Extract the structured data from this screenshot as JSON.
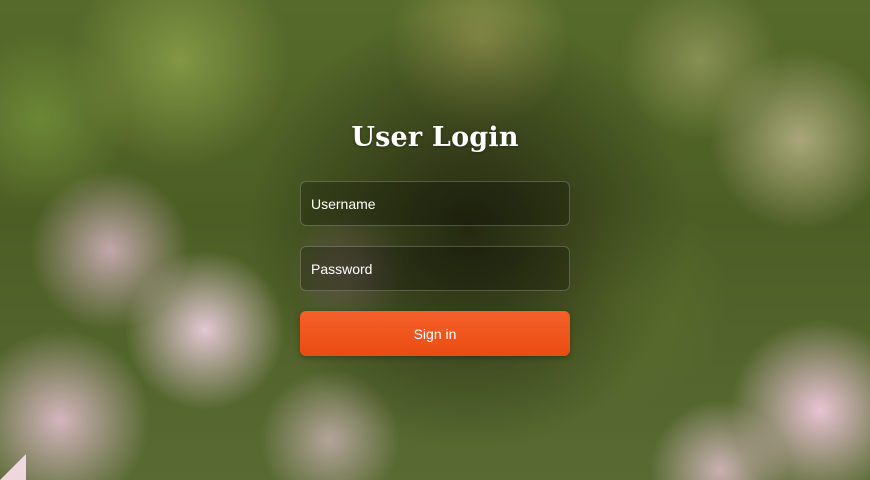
{
  "login": {
    "title": "User Login",
    "username_placeholder": "Username",
    "password_placeholder": "Password",
    "signin_label": "Sign in"
  },
  "colors": {
    "accent": "#ef5517",
    "text": "#ffffff"
  }
}
